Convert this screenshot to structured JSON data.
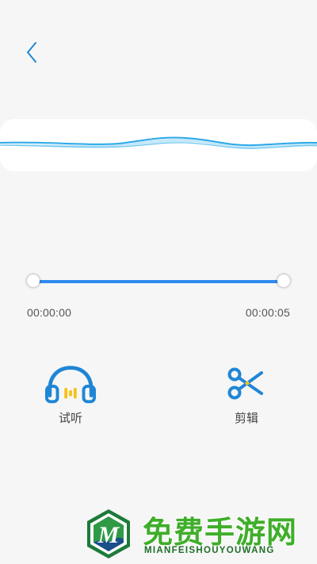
{
  "header": {
    "back_icon": "chevron-left-icon"
  },
  "waveform": {
    "color": "#2aa8e8"
  },
  "trim": {
    "start_time": "00:00:00",
    "end_time": "00:00:05",
    "start_fraction": 0,
    "end_fraction": 1,
    "accent_color": "#2f8bef"
  },
  "actions": {
    "listen": {
      "label": "试听",
      "icon": "headphones-icon"
    },
    "cut": {
      "label": "剪辑",
      "icon": "scissors-icon"
    }
  },
  "watermark": {
    "title": "免费手游网",
    "subtitle": "MIANFEISHOUYOUWANG"
  }
}
